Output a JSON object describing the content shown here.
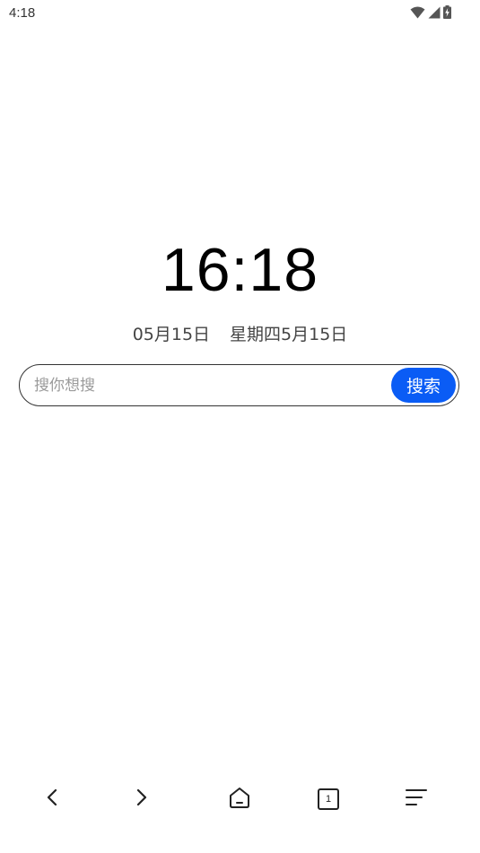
{
  "status_bar": {
    "time": "4:18",
    "icons": [
      "wifi-icon",
      "signal-icon",
      "battery-charging-icon"
    ]
  },
  "clock": {
    "time": "16:18"
  },
  "date": {
    "solar": "05月15日",
    "weekday_lunar": "星期四5月15日"
  },
  "search": {
    "placeholder": "搜你想搜",
    "value": "",
    "button_label": "搜索",
    "accent_color": "#0a5cf5"
  },
  "bottom_nav": {
    "items": [
      {
        "icon": "back-arrow-icon"
      },
      {
        "icon": "forward-arrow-icon"
      },
      {
        "icon": "home-icon"
      },
      {
        "icon": "tabs-icon",
        "count": "1"
      },
      {
        "icon": "menu-icon"
      }
    ]
  }
}
